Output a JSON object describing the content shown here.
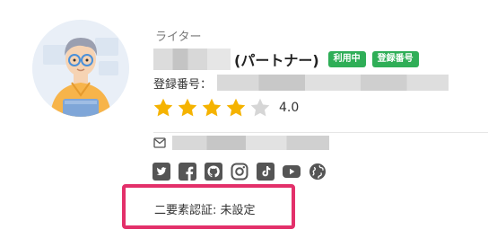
{
  "profile": {
    "role": "ライター",
    "name_suffix": "(パートナー)",
    "badges": [
      "利用中",
      "登録番号"
    ],
    "registration_label": "登録番号：",
    "rating": {
      "value_label": "4.0",
      "value": 4.0,
      "max": 5
    },
    "social_icons": [
      "twitter-icon",
      "facebook-icon",
      "github-icon",
      "instagram-icon",
      "tiktok-icon",
      "youtube-icon",
      "globe-icon"
    ],
    "two_factor": "二要素認証: 未設定"
  },
  "colors": {
    "badge_green": "#2fae57",
    "star_filled": "#f5b301",
    "star_empty": "#d6d6d6",
    "highlight_border": "#e3306a",
    "icon_gray": "#555555"
  }
}
